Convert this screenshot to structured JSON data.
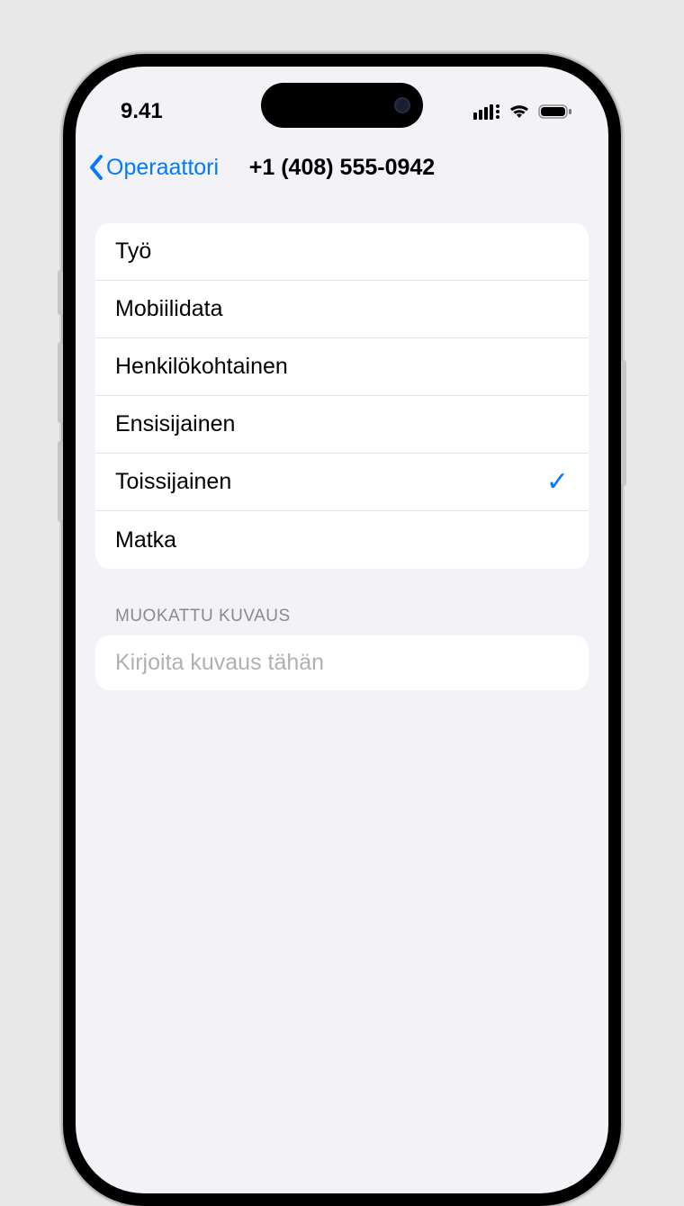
{
  "status": {
    "time": "9.41"
  },
  "nav": {
    "back_label": "Operaattori",
    "title": "+1 (408) 555-0942"
  },
  "labels": [
    {
      "text": "Työ",
      "selected": false
    },
    {
      "text": "Mobiilidata",
      "selected": false
    },
    {
      "text": "Henkilökohtainen",
      "selected": false
    },
    {
      "text": "Ensisijainen",
      "selected": false
    },
    {
      "text": "Toissijainen",
      "selected": true
    },
    {
      "text": "Matka",
      "selected": false
    }
  ],
  "custom": {
    "header": "MUOKATTU KUVAUS",
    "placeholder": "Kirjoita kuvaus tähän",
    "value": ""
  }
}
